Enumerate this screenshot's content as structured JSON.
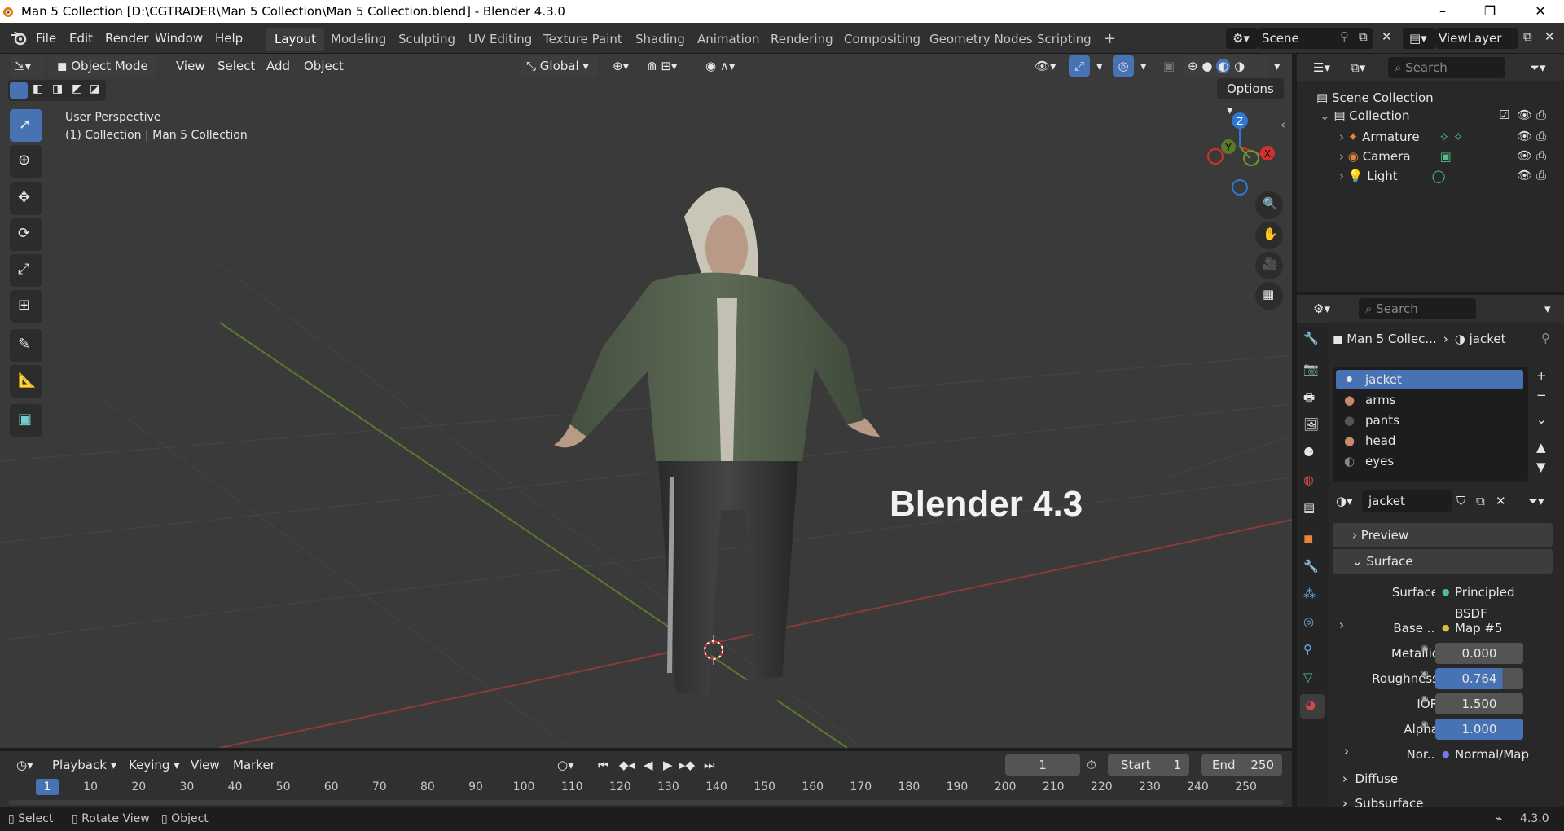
{
  "window": {
    "title": "Man 5 Collection [D:\\CGTRADER\\Man 5 Collection\\Man 5 Collection.blend] - Blender 4.3.0"
  },
  "menubar": {
    "items": [
      "File",
      "Edit",
      "Render",
      "Window",
      "Help"
    ]
  },
  "workspaces": [
    "Layout",
    "Modeling",
    "Sculpting",
    "UV Editing",
    "Texture Paint",
    "Shading",
    "Animation",
    "Rendering",
    "Compositing",
    "Geometry Nodes",
    "Scripting"
  ],
  "scene": {
    "name": "Scene",
    "view_layer": "ViewLayer"
  },
  "viewport": {
    "mode": "Object Mode",
    "menus": [
      "View",
      "Select",
      "Add",
      "Object"
    ],
    "orientation": "Global",
    "options_label": "Options",
    "info_line1": "User Perspective",
    "info_line2": "(1) Collection | Man 5 Collection",
    "overlay_text": "Blender 4.3",
    "gizmo": {
      "z": "Z",
      "y": "Y",
      "x": "X"
    }
  },
  "outliner": {
    "search_placeholder": "Search",
    "root": "Scene Collection",
    "collection": "Collection",
    "items": [
      "Armature",
      "Camera",
      "Light"
    ]
  },
  "properties": {
    "search_placeholder": "Search",
    "breadcrumb_object": "Man 5 Collec...",
    "breadcrumb_material": "jacket",
    "slots": [
      "jacket",
      "arms",
      "pants",
      "head",
      "eyes"
    ],
    "material_name": "jacket",
    "panels": {
      "preview": "Preview",
      "surface": "Surface",
      "diffuse": "Diffuse",
      "subsurface": "Subsurface"
    },
    "fields": {
      "surface_label": "Surface",
      "surface_value": "Principled BSDF",
      "base_label": "Base ...",
      "base_value": "Map #5",
      "metallic_label": "Metallic",
      "metallic_value": "0.000",
      "roughness_label": "Roughness",
      "roughness_value": "0.764",
      "ior_label": "IOR",
      "ior_value": "1.500",
      "alpha_label": "Alpha",
      "alpha_value": "1.000",
      "normal_label": "Nor...",
      "normal_value": "Normal/Map"
    }
  },
  "timeline": {
    "menus": [
      "Playback",
      "Keying",
      "View",
      "Marker"
    ],
    "current_frame": "1",
    "start_label": "Start",
    "start_value": "1",
    "end_label": "End",
    "end_value": "250",
    "ticks": [
      "1",
      "10",
      "20",
      "30",
      "40",
      "50",
      "60",
      "70",
      "80",
      "90",
      "100",
      "110",
      "120",
      "130",
      "140",
      "150",
      "160",
      "170",
      "180",
      "190",
      "200",
      "210",
      "220",
      "230",
      "240",
      "250"
    ]
  },
  "statusbar": {
    "items": [
      "Select",
      "Rotate View",
      "Object"
    ],
    "version": "4.3.0"
  },
  "colors": {
    "accent": "#4772b3",
    "bg": "#303030",
    "viewport": "#3a3a3a",
    "panel": "#282828"
  }
}
